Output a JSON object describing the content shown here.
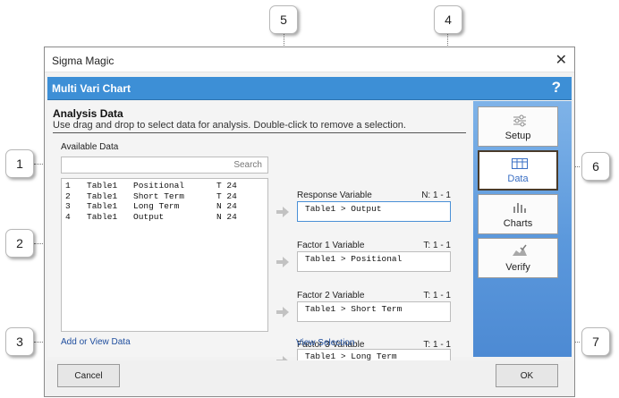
{
  "window": {
    "title": "Sigma Magic",
    "close_glyph": "✕"
  },
  "banner": {
    "title": "Multi Vari Chart",
    "help_glyph": "?"
  },
  "section": {
    "heading": "Analysis Data",
    "instructions": "Use drag and drop to select data for analysis. Double-click to remove a selection."
  },
  "available": {
    "label": "Available Data",
    "search_placeholder": "Search",
    "rows": [
      {
        "num": "1",
        "table": "Table1",
        "name": "Positional",
        "type": "T 24"
      },
      {
        "num": "2",
        "table": "Table1",
        "name": "Short Term",
        "type": "T 24"
      },
      {
        "num": "3",
        "table": "Table1",
        "name": "Long Term",
        "type": "N 24"
      },
      {
        "num": "4",
        "table": "Table1",
        "name": "Output",
        "type": "N 24"
      }
    ],
    "add_link": "Add or View Data"
  },
  "variables": [
    {
      "label": "Response Variable",
      "count": "N: 1 - 1",
      "value": "Table1 > Output"
    },
    {
      "label": "Factor 1 Variable",
      "count": "T: 1 - 1",
      "value": "Table1 > Positional"
    },
    {
      "label": "Factor 2 Variable",
      "count": "T: 1 - 1",
      "value": "Table1 > Short Term"
    },
    {
      "label": "Factor 3 Variable",
      "count": "T: 1 - 1",
      "value": "Table1 > Long Term"
    }
  ],
  "view_selection": "View Selection",
  "nav": [
    {
      "label": "Setup",
      "icon": "sliders-icon"
    },
    {
      "label": "Data",
      "icon": "table-grid-icon",
      "selected": true
    },
    {
      "label": "Charts",
      "icon": "bar-chart-icon"
    },
    {
      "label": "Verify",
      "icon": "verify-check-icon"
    }
  ],
  "footer": {
    "cancel": "Cancel",
    "ok": "OK"
  },
  "callouts": [
    "1",
    "2",
    "3",
    "4",
    "5",
    "6",
    "7"
  ],
  "colors": {
    "banner": "#3d8fd6",
    "sidebar": "#5b98dc",
    "link": "#1f4e9e",
    "selected_nav": "#3a6fc4"
  }
}
